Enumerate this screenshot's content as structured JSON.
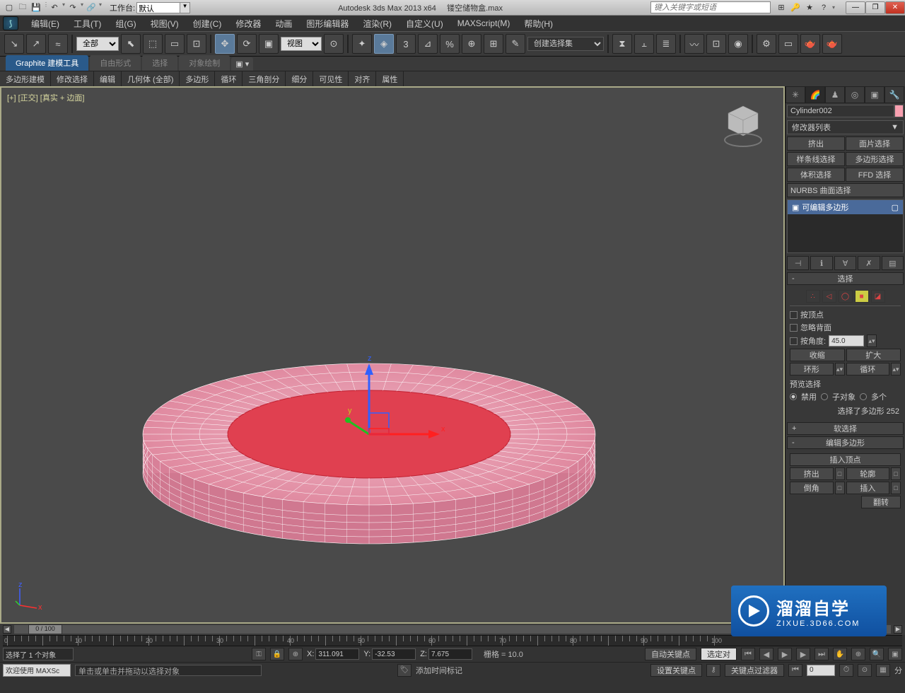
{
  "title": {
    "app": "Autodesk 3ds Max  2013 x64",
    "file": "镂空储物盒.max",
    "workspace_label": "工作台:",
    "workspace_value": "默认",
    "search_placeholder": "键入关键字或短语"
  },
  "menus": [
    "编辑(E)",
    "工具(T)",
    "组(G)",
    "视图(V)",
    "创建(C)",
    "修改器",
    "动画",
    "图形编辑器",
    "渲染(R)",
    "自定义(U)",
    "MAXScript(M)",
    "帮助(H)"
  ],
  "main_toolbar": {
    "filter_combo": "全部",
    "view_combo": "视图",
    "named_sel": "创建选择集"
  },
  "ribbon": {
    "tabs": [
      "Graphite 建模工具",
      "自由形式",
      "选择",
      "对象绘制"
    ],
    "active": 0,
    "panel": [
      "多边形建模",
      "修改选择",
      "编辑",
      "几何体 (全部)",
      "多边形",
      "循环",
      "三角剖分",
      "细分",
      "可见性",
      "对齐",
      "属性"
    ]
  },
  "viewport": {
    "label": "[+] [正交] [真实 + 边面]"
  },
  "cmd": {
    "object_name": "Cylinder002",
    "modifier_list": "修改器列表",
    "mod_row1": [
      "挤出",
      "面片选择"
    ],
    "mod_row2": [
      "样条线选择",
      "多边形选择"
    ],
    "mod_row3": [
      "体积选择",
      "FFD 选择"
    ],
    "mod_label_nurbs": "NURBS 曲面选择",
    "stack_item": "可编辑多边形",
    "rollout_select": "选择",
    "chk_byvertex": "按顶点",
    "chk_ignoreback": "忽略背面",
    "chk_byangle": "按角度:",
    "angle_value": "45.0",
    "btn_shrink": "收缩",
    "btn_grow": "扩大",
    "btn_ring": "环形",
    "btn_loop": "循环",
    "preview_label": "预览选择",
    "radio_labels": [
      "禁用",
      "子对象",
      "多个"
    ],
    "sel_count": "选择了多边形 252",
    "rollout_soft": "软选择",
    "rollout_editpoly": "编辑多边形",
    "insert_vertex": "插入顶点",
    "row_extrude": [
      "挤出",
      "轮廓"
    ],
    "row_bevel": [
      "倒角",
      "插入"
    ],
    "flip_label": "翻转"
  },
  "status": {
    "slider_label": "0 / 100",
    "sel_info": "选择了 1 个对象",
    "x": "311.091",
    "y": "-32.53",
    "z": "7.675",
    "grid": "栅格 = 10.0",
    "autokey": "自动关键点",
    "selected": "选定对",
    "welcome": "欢迎使用  MAXSc",
    "prompt": "单击或单击并拖动以选择对象",
    "addtime": "添加时间标记",
    "setkey": "设置关键点",
    "keyfilter": "关键点过滤器",
    "frame": "0",
    "share": "分"
  },
  "watermark": {
    "t1": "溜溜自学",
    "t2": "ZIXUE.3D66.COM"
  }
}
